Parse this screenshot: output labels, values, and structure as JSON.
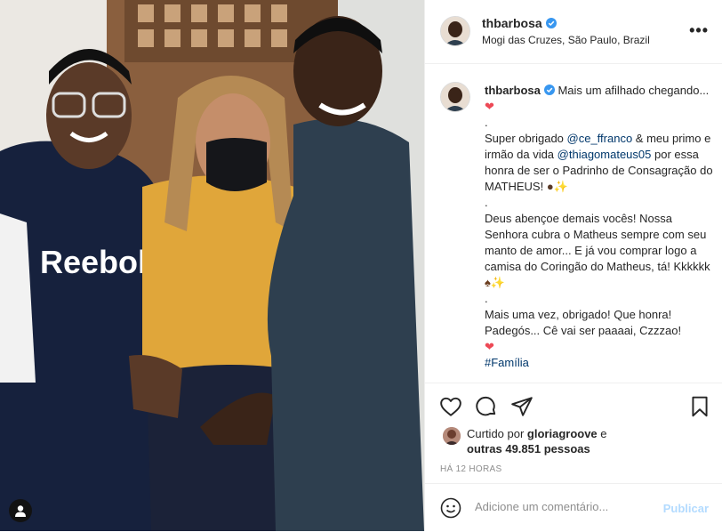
{
  "post": {
    "username": "thbarbosa",
    "location": "Mogi das Cruzes, São Paulo, Brazil",
    "more_label": "•••",
    "photo_shirt_brand": "Reebok",
    "caption": {
      "l1": "Mais um afilhado chegando... ",
      "l2": ".",
      "l3a": "Super obrigado ",
      "m1": "@ce_ffranco",
      "l3b": " & meu primo e irmão da vida ",
      "m2": "@thiagomateus05",
      "l3c": " por essa honra de ser o Padrinho de Consagração do MATHEUS! ",
      "l4": ".",
      "l5": "Deus abençoe demais vocês! Nossa Senhora cubra o Matheus sempre com seu manto de amor... E já vou comprar logo a camisa do Coringão do Matheus, tá! Kkkkkk ",
      "l6": ".",
      "l7": "Mais uma vez, obrigado! Que honra! Padegós... Cê vai ser paaaai, Czzzao!",
      "hashtag": "#Família"
    },
    "likes": {
      "prefix": "Curtido por ",
      "user": "gloriagroove",
      "mid": " e ",
      "others": "outras 49.851 pessoas"
    },
    "time": "HÁ 12 HORAS"
  },
  "comment": {
    "placeholder": "Adicione um comentário...",
    "publish_label": "Publicar"
  },
  "colors": {
    "link": "#00376b",
    "verified": "#3897f0",
    "publish_disabled": "#b3dbff",
    "heart": "#ed4956"
  }
}
